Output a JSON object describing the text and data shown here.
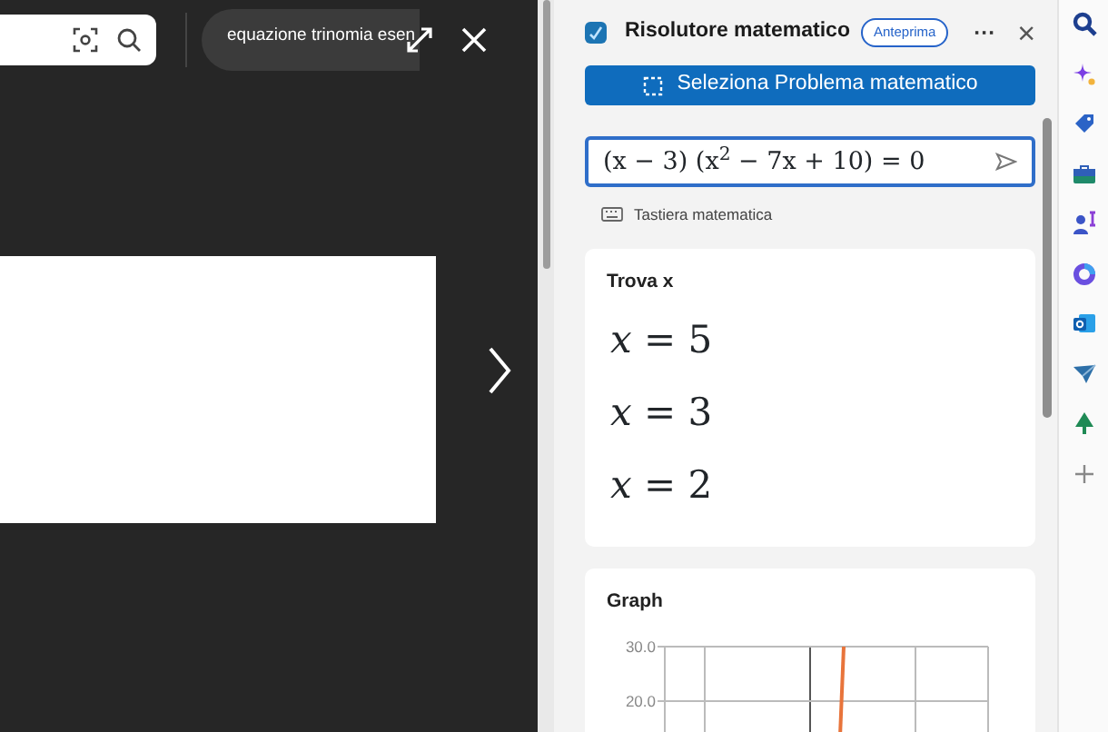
{
  "browser": {
    "search_tab": {
      "title": "equazione trinomia esen"
    }
  },
  "panel": {
    "title": "Risolutore matematico",
    "badge": "Anteprima",
    "more": "···",
    "close": "×",
    "select_button": "Seleziona Problema matematico",
    "input": {
      "value": "(x − 3) (x$^{2}$ − 7x + 10) = 0"
    },
    "keyboard_link": "Tastiera matematica",
    "result": {
      "title": "Trova x",
      "solutions": [
        "*x* = 5",
        "*x* = 3",
        "*x* = 2"
      ]
    },
    "graph": {
      "title": "Graph",
      "tick_labels": [
        "30.0",
        "20.0"
      ]
    }
  }
}
